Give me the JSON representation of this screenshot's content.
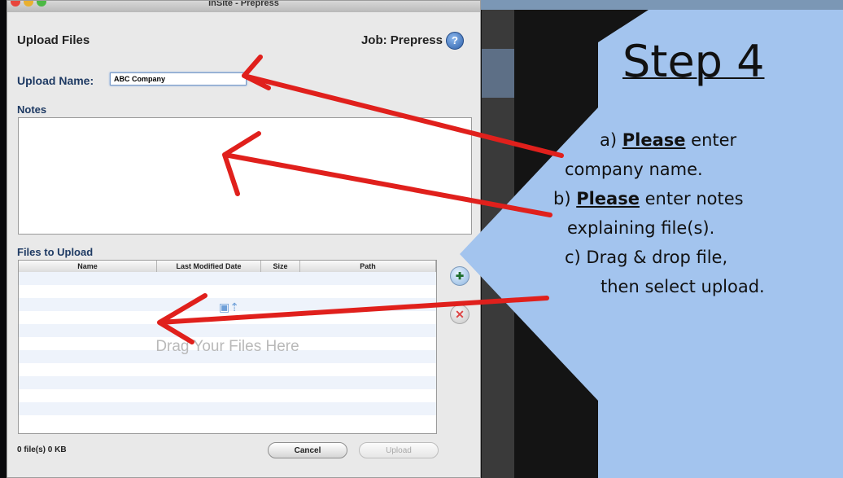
{
  "window": {
    "title": "InSite - Prepress"
  },
  "dialog": {
    "title": "Upload Files",
    "job_label": "Job: Prepress",
    "help_icon": "help-icon",
    "upload_name_label": "Upload Name:",
    "upload_name_value": "ABC Company",
    "notes_label": "Notes",
    "files_label": "Files to Upload",
    "columns": [
      "Name",
      "Last Modified Date",
      "Size",
      "Path"
    ],
    "drop_text": "Drag Your Files Here",
    "status": "0 file(s) 0 KB",
    "cancel_label": "Cancel",
    "upload_label": "Upload"
  },
  "instructions": {
    "step_title": "Step 4",
    "a_prefix": "a) ",
    "a_please": "Please",
    "a_rest": " enter",
    "a_line2": "company name.",
    "b_prefix": "b) ",
    "b_please": "Please",
    "b_rest": " enter notes",
    "b_line2": "explaining file(s).",
    "c_line1": "c) Drag & drop file,",
    "c_line2": "then select upload."
  },
  "colors": {
    "panel_blue": "#a3c4ee",
    "arrow_red": "#e0201c",
    "header_blue": "#1e3a63"
  }
}
